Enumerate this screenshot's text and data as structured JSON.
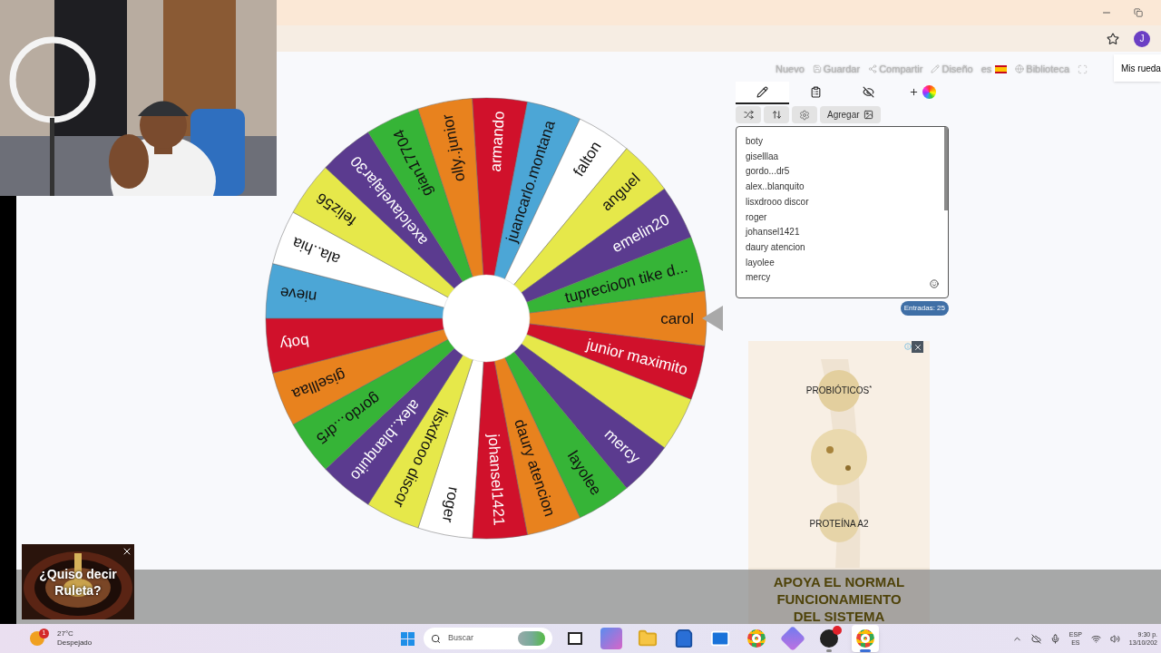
{
  "browser": {
    "profile_initial": "J"
  },
  "nav": [
    {
      "kind": "new",
      "label": "Nuevo"
    },
    {
      "kind": "save",
      "label": "Guardar"
    },
    {
      "kind": "share",
      "label": "Compartir"
    },
    {
      "kind": "design",
      "label": "Diseño"
    },
    {
      "kind": "language",
      "label": "es"
    },
    {
      "kind": "library",
      "label": "Biblioteca"
    }
  ],
  "my_wheels_tab": "Mis rueda",
  "editor_tabs": [
    {
      "kind": "edit",
      "selected": true
    },
    {
      "kind": "results",
      "selected": false
    },
    {
      "kind": "hide",
      "selected": false
    },
    {
      "kind": "customize",
      "selected": false
    }
  ],
  "toolbar": {
    "add_image_label": "Agregar"
  },
  "entries": [
    "boty",
    "giselllaa",
    "gordo...dr5",
    "alex..blanquito",
    "lisxdrooo discor",
    "roger",
    "johansel1421",
    "daury atencion",
    "layolee",
    "mercy"
  ],
  "entries_count": "Entradas: 25",
  "wheel": {
    "segments": [
      {
        "label": "carol",
        "color": "#e8821e"
      },
      {
        "label": "junior maximito",
        "color": "#d0112b"
      },
      {
        "color": "#e6e84a"
      },
      {
        "label": "mercy",
        "color": "#5b3b8f"
      },
      {
        "label": "layolee",
        "color": "#36b437"
      },
      {
        "label": "daury atencion",
        "color": "#e8821e"
      },
      {
        "label": "johansel1421",
        "color": "#d0112b"
      },
      {
        "label": "roger",
        "color": "#ffffff"
      },
      {
        "label": "lisxdrooo discor",
        "color": "#e6e84a"
      },
      {
        "label": "alex..blanquito",
        "color": "#5b3b8f"
      },
      {
        "label": "gordo...dr5",
        "color": "#36b437"
      },
      {
        "label": "giselllaa",
        "color": "#e8821e"
      },
      {
        "label": "boty",
        "color": "#d0112b"
      },
      {
        "label": "nieve",
        "color": "#4ca6d6"
      },
      {
        "label": "ala..hia",
        "color": "#ffffff"
      },
      {
        "label": "feliz56",
        "color": "#e6e84a"
      },
      {
        "label": "axelclavelajar30",
        "color": "#5b3b8f"
      },
      {
        "label": "gian17704",
        "color": "#36b437"
      },
      {
        "label": "olly..junior",
        "color": "#e8821e"
      },
      {
        "label": "armando",
        "color": "#d0112b"
      },
      {
        "label": "juancarlo.montana",
        "color": "#4ca6d6"
      },
      {
        "label": "falton",
        "color": "#ffffff"
      },
      {
        "label": "anguel",
        "color": "#e6e84a"
      },
      {
        "label": "emelin20",
        "color": "#5b3b8f"
      },
      {
        "label": "tuprecio0n tike d...",
        "color": "#36b437"
      }
    ]
  },
  "ad": {
    "top_label": "PROBIÓTICOS$^{*}$",
    "bottom_label": "PROTEÍNA A2",
    "headline_lines": [
      "APOYA EL NORMAL",
      "FUNCIONAMIENTO",
      "DEL SISTEMA"
    ]
  },
  "popup": {
    "lines": [
      "¿Quiso decir",
      "Ruleta?"
    ]
  },
  "taskbar": {
    "weather": {
      "badge": "1",
      "temperature": "27°C",
      "condition": "Despejado"
    },
    "search_placeholder": "Buscar",
    "apps": [
      {
        "kind": "taskview",
        "running": false,
        "selected": false
      },
      {
        "kind": "copilot",
        "running": false,
        "selected": false
      },
      {
        "kind": "files",
        "running": false,
        "selected": false
      },
      {
        "kind": "store",
        "running": false,
        "selected": false
      },
      {
        "kind": "mail",
        "running": false,
        "selected": false
      },
      {
        "kind": "browser",
        "running": false,
        "selected": false
      },
      {
        "kind": "hexagon",
        "running": false,
        "selected": false
      },
      {
        "kind": "recorder",
        "running": true,
        "selected": false
      },
      {
        "kind": "browser",
        "running": true,
        "selected": true
      }
    ],
    "language": "ESP",
    "region": "ES",
    "time": "9:30 p.",
    "date": "13/10/202"
  }
}
